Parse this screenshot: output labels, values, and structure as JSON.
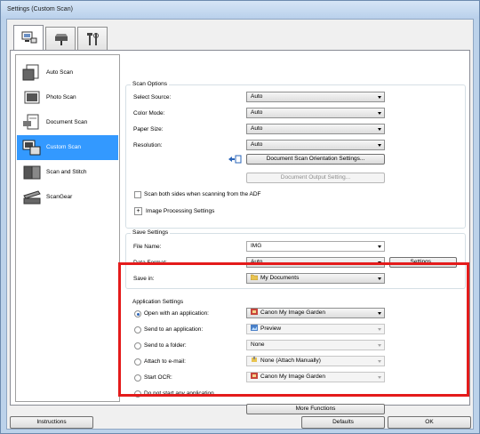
{
  "window": {
    "title": "Settings (Custom Scan)"
  },
  "tabs": [
    {
      "name": "scan-from-computer",
      "icon": "computer-scan-icon"
    },
    {
      "name": "scan-from-operation-panel",
      "icon": "scanner-icon"
    },
    {
      "name": "general-settings",
      "icon": "tools-icon"
    }
  ],
  "sidebar": {
    "items": [
      {
        "label": "Auto Scan",
        "icon": "auto-scan-icon",
        "selected": false
      },
      {
        "label": "Photo Scan",
        "icon": "photo-scan-icon",
        "selected": false
      },
      {
        "label": "Document Scan",
        "icon": "document-scan-icon",
        "selected": false
      },
      {
        "label": "Custom Scan",
        "icon": "custom-scan-icon",
        "selected": true
      },
      {
        "label": "Scan and Stitch",
        "icon": "stitch-icon",
        "selected": false
      },
      {
        "label": "ScanGear",
        "icon": "scangear-icon",
        "selected": false
      }
    ]
  },
  "scan_options": {
    "title": "Scan Options",
    "select_source_label": "Select Source:",
    "select_source_value": "Auto",
    "color_mode_label": "Color Mode:",
    "color_mode_value": "Auto",
    "paper_size_label": "Paper Size:",
    "paper_size_value": "Auto",
    "resolution_label": "Resolution:",
    "resolution_value": "Auto",
    "orientation_button": "Document Scan Orientation Settings...",
    "output_button": "Document Output Setting...",
    "scan_both_sides": "Scan both sides when scanning from the ADF",
    "image_processing": "Image Processing Settings"
  },
  "save_settings": {
    "title": "Save Settings",
    "file_name_label": "File Name:",
    "file_name_value": "IMG",
    "data_format_label": "Data Format:",
    "data_format_value": "Auto",
    "settings_button": "Settings...",
    "save_in_label": "Save in:",
    "save_in_value": "My Documents"
  },
  "application_settings": {
    "title": "Application Settings",
    "open_with_label": "Open with an application:",
    "open_with_value": "Canon My Image Garden",
    "send_app_label": "Send to an application:",
    "send_app_value": "Preview",
    "send_folder_label": "Send to a folder:",
    "send_folder_value": "None",
    "attach_email_label": "Attach to e-mail:",
    "attach_email_value": "None (Attach Manually)",
    "start_ocr_label": "Start OCR:",
    "start_ocr_value": "Canon My Image Garden",
    "no_app_label": "Do not start any application",
    "more_functions": "More Functions",
    "selected_option": "open_with"
  },
  "footer": {
    "instructions": "Instructions",
    "defaults": "Defaults",
    "ok": "OK"
  },
  "colors": {
    "highlight": "#e41b1b",
    "selection": "#3399ff"
  }
}
